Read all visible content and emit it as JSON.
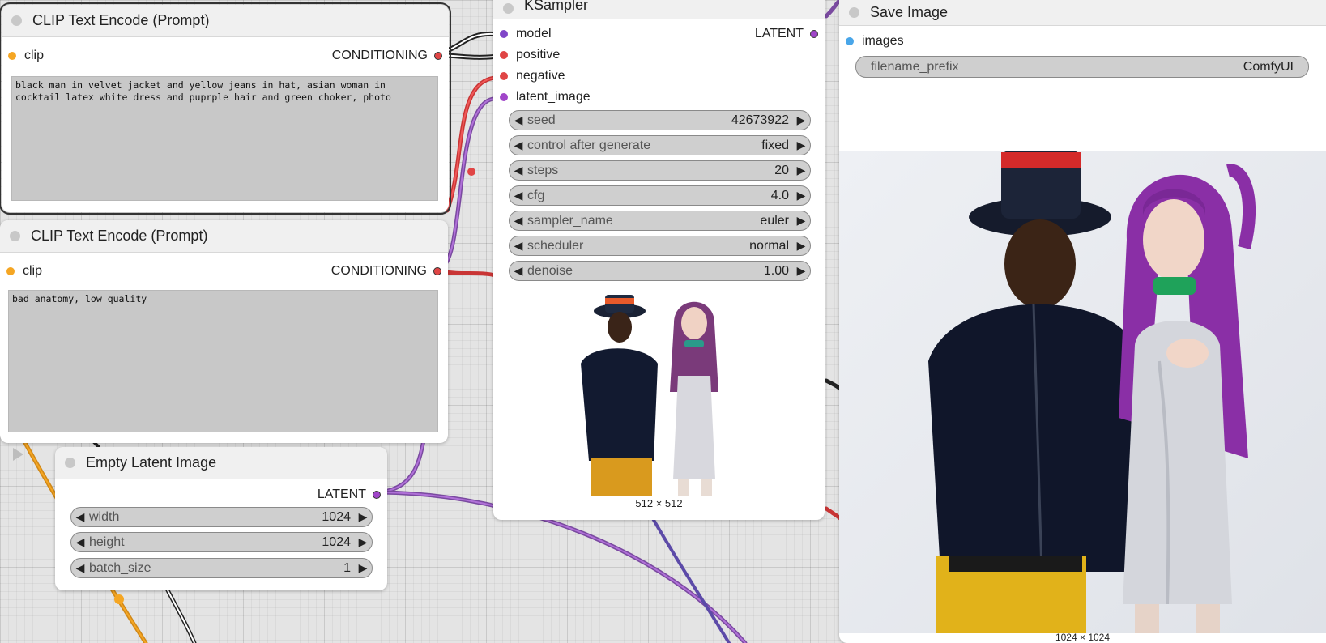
{
  "clip_positive": {
    "title": "CLIP Text Encode (Prompt)",
    "input_clip": "clip",
    "output": "CONDITIONING",
    "text": "black man in velvet jacket and yellow jeans in hat, asian woman in\ncocktail latex white dress and puprple hair and green choker, photo"
  },
  "clip_negative": {
    "title": "CLIP Text Encode (Prompt)",
    "input_clip": "clip",
    "output": "CONDITIONING",
    "text": "bad anatomy, low quality"
  },
  "empty_latent": {
    "title": "Empty Latent Image",
    "output": "LATENT",
    "widgets": [
      {
        "label": "width",
        "value": "1024"
      },
      {
        "label": "height",
        "value": "1024"
      },
      {
        "label": "batch_size",
        "value": "1"
      }
    ]
  },
  "ksampler": {
    "title": "KSampler",
    "output": "LATENT",
    "inputs": [
      "model",
      "positive",
      "negative",
      "latent_image"
    ],
    "widgets": [
      {
        "label": "seed",
        "value": "42673922"
      },
      {
        "label": "control after generate",
        "value": "fixed"
      },
      {
        "label": "steps",
        "value": "20"
      },
      {
        "label": "cfg",
        "value": "4.0"
      },
      {
        "label": "sampler_name",
        "value": "euler"
      },
      {
        "label": "scheduler",
        "value": "normal"
      },
      {
        "label": "denoise",
        "value": "1.00"
      }
    ],
    "preview_caption": "512 × 512"
  },
  "save_image": {
    "title": "Save Image",
    "input": "images",
    "widget": {
      "label": "filename_prefix",
      "value": "ComfyUI"
    },
    "image_caption": "1024 × 1024"
  },
  "widget_arrows": {
    "left": "◀",
    "right": "▶"
  },
  "colors": {
    "clip": "#f5a623",
    "conditioning": "#e04545",
    "latent": "#a045c9",
    "model": "#8046c8",
    "image": "#49a6e9"
  }
}
